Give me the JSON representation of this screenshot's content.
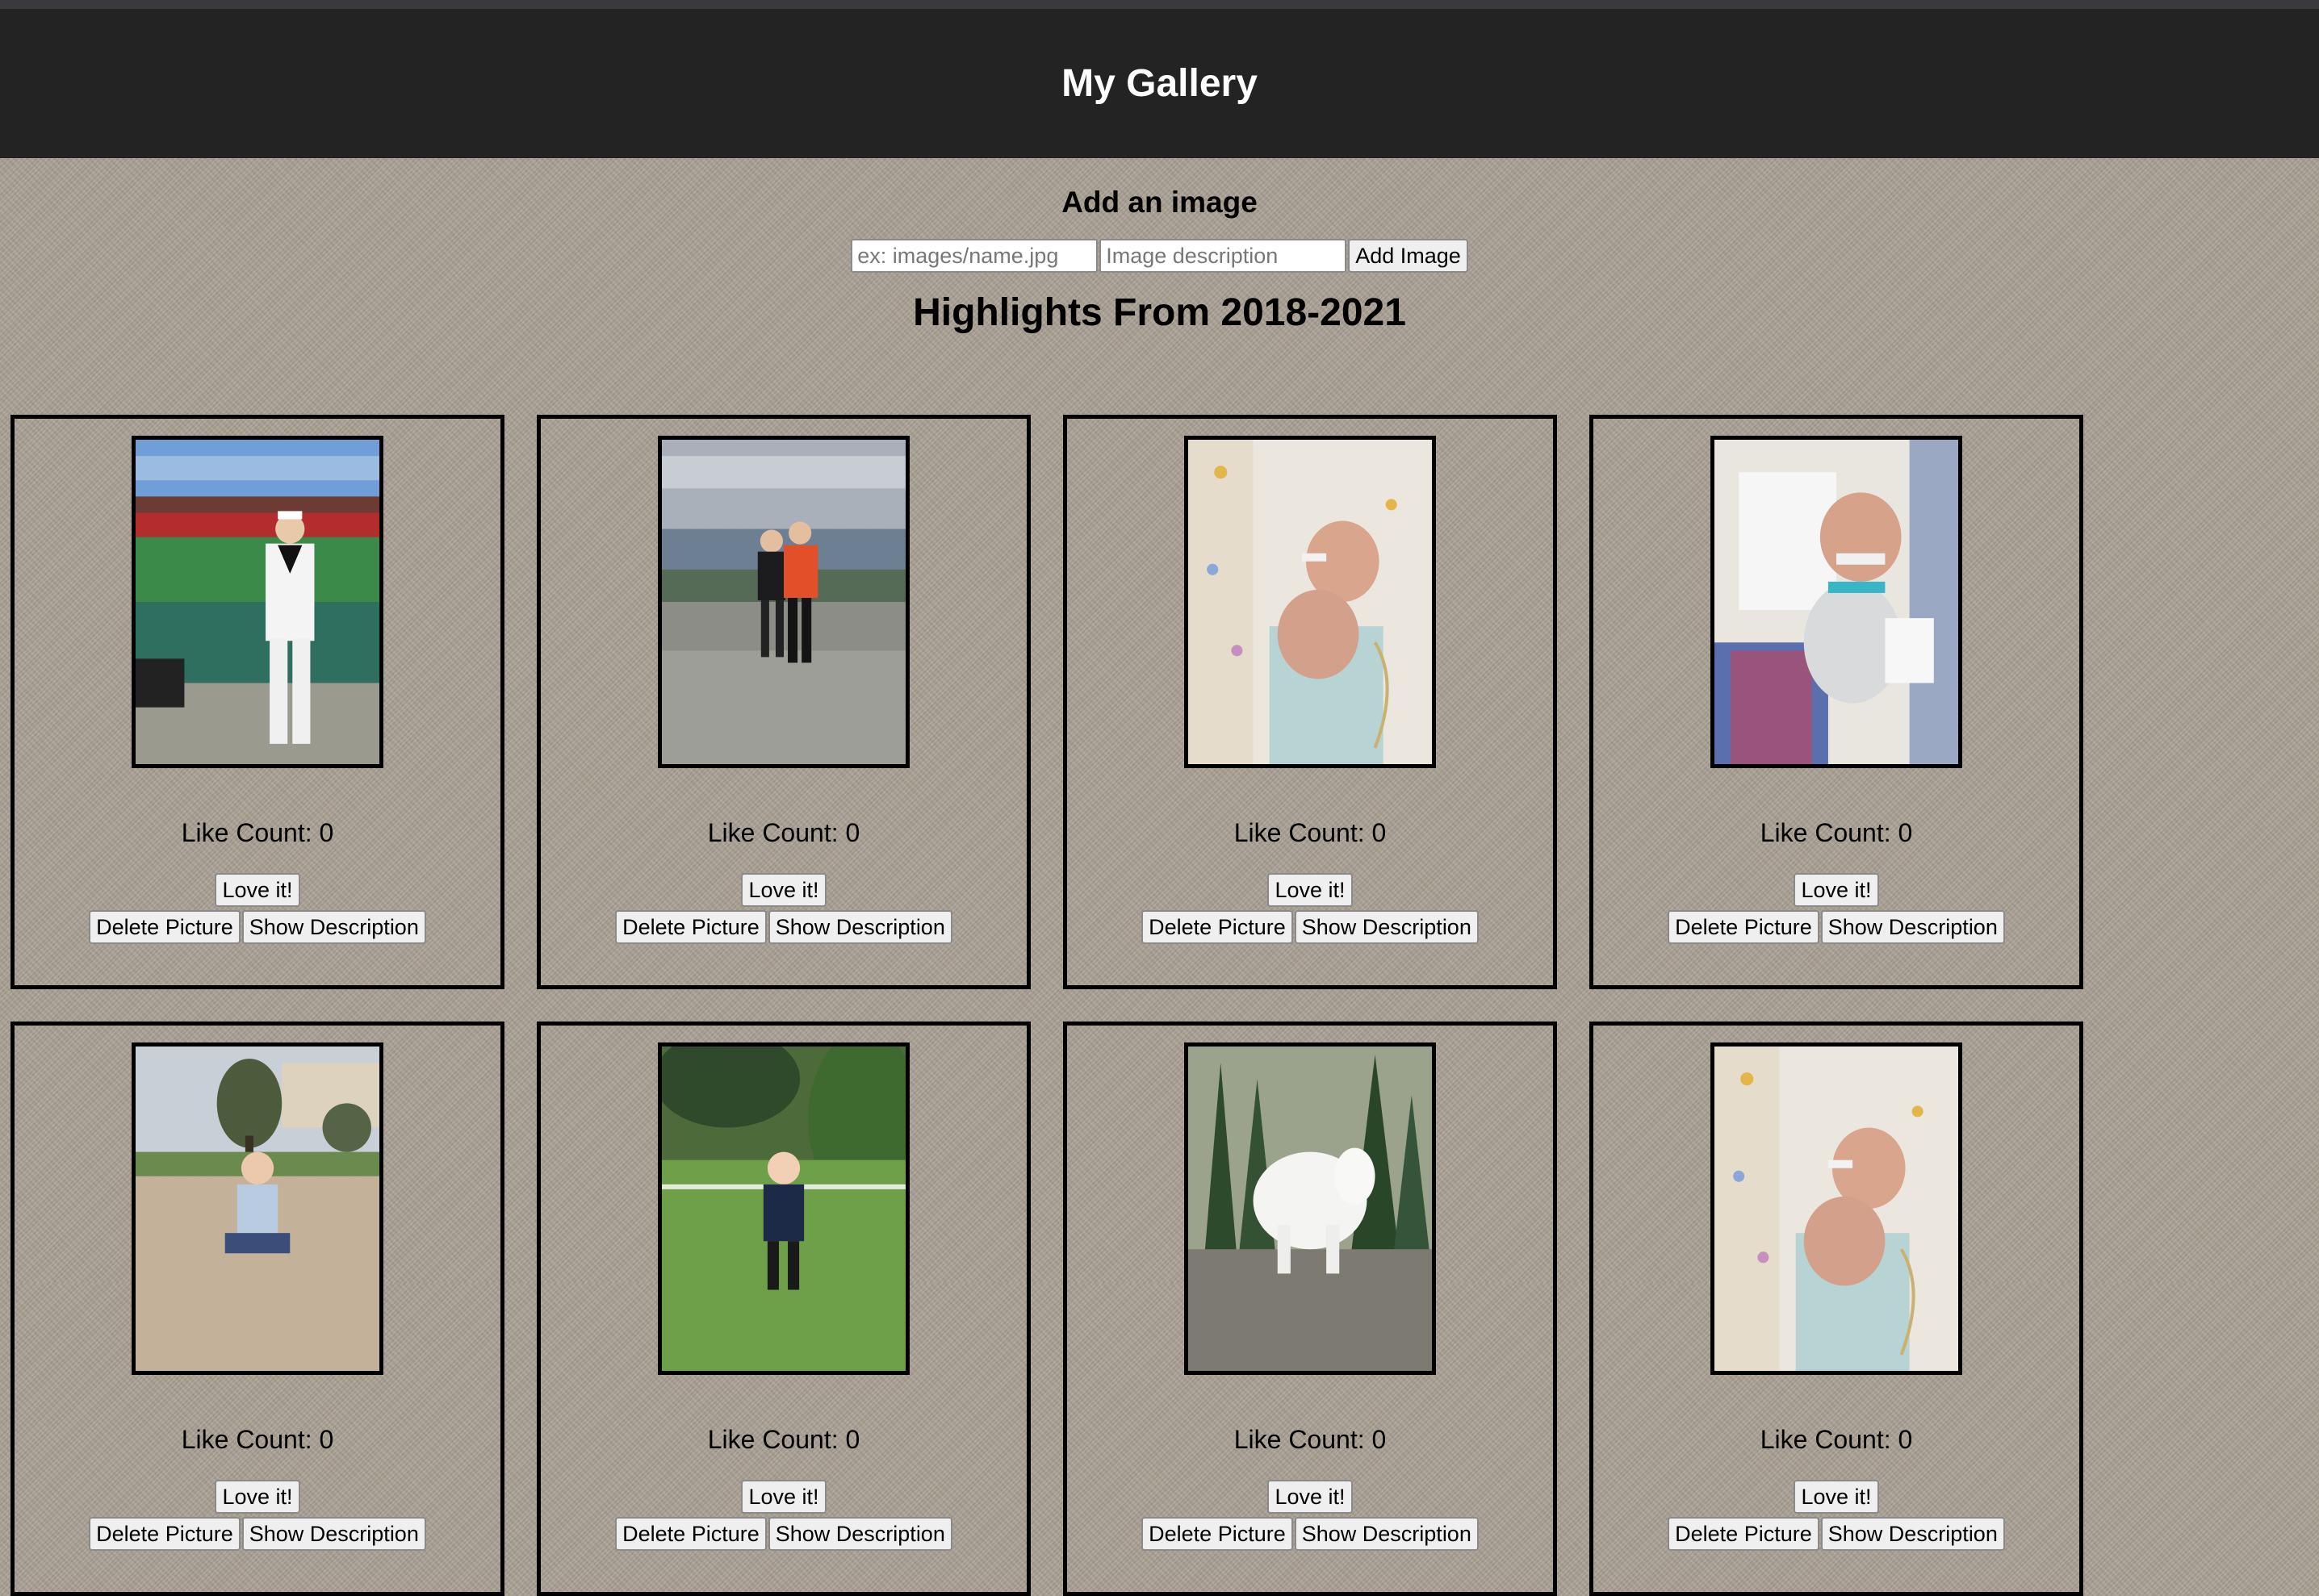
{
  "header": {
    "title": "My Gallery"
  },
  "add_section": {
    "heading": "Add an image",
    "url_placeholder": "ex: images/name.jpg",
    "desc_placeholder": "Image description",
    "add_button": "Add Image"
  },
  "gallery": {
    "title": "Highlights From 2018-2021",
    "like_label": "Like Count: 0",
    "love_button": "Love it!",
    "delete_button": "Delete Picture",
    "show_desc_button": "Show Description",
    "cards": [
      {
        "subject": "sailor-at-ballpark"
      },
      {
        "subject": "couple-on-mountain"
      },
      {
        "subject": "newborn-in-blanket"
      },
      {
        "subject": "newborn-in-crib"
      },
      {
        "subject": "toddler-on-sand"
      },
      {
        "subject": "toddler-in-garden"
      },
      {
        "subject": "mountain-goat"
      },
      {
        "subject": "newborn-in-blanket"
      }
    ]
  }
}
